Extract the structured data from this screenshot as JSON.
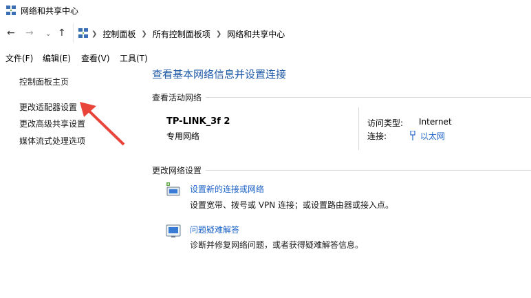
{
  "window": {
    "title": "网络和共享中心"
  },
  "breadcrumb": [
    "控制面板",
    "所有控制面板项",
    "网络和共享中心"
  ],
  "menu": [
    "文件(F)",
    "编辑(E)",
    "查看(V)",
    "工具(T)"
  ],
  "sidebar": {
    "home": "控制面板主页",
    "links": [
      "更改适配器设置",
      "更改高级共享设置",
      "媒体流式处理选项"
    ]
  },
  "main": {
    "title": "查看基本网络信息并设置连接",
    "active_section": "查看活动网络",
    "network": {
      "name": "TP-LINK_3f 2",
      "type": "专用网络",
      "access_label": "访问类型:",
      "access_value": "Internet",
      "conn_label": "连接:",
      "conn_value": "以太网"
    },
    "change_section": "更改网络设置",
    "tasks": [
      {
        "link": "设置新的连接或网络",
        "desc": "设置宽带、拨号或 VPN 连接；或设置路由器或接入点。"
      },
      {
        "link": "问题疑难解答",
        "desc": "诊断并修复网络问题，或者获得疑难解答信息。"
      }
    ]
  },
  "colors": {
    "link": "#1e64c8",
    "title": "#1e5aa8",
    "annotation_arrow": "#e8443a"
  }
}
